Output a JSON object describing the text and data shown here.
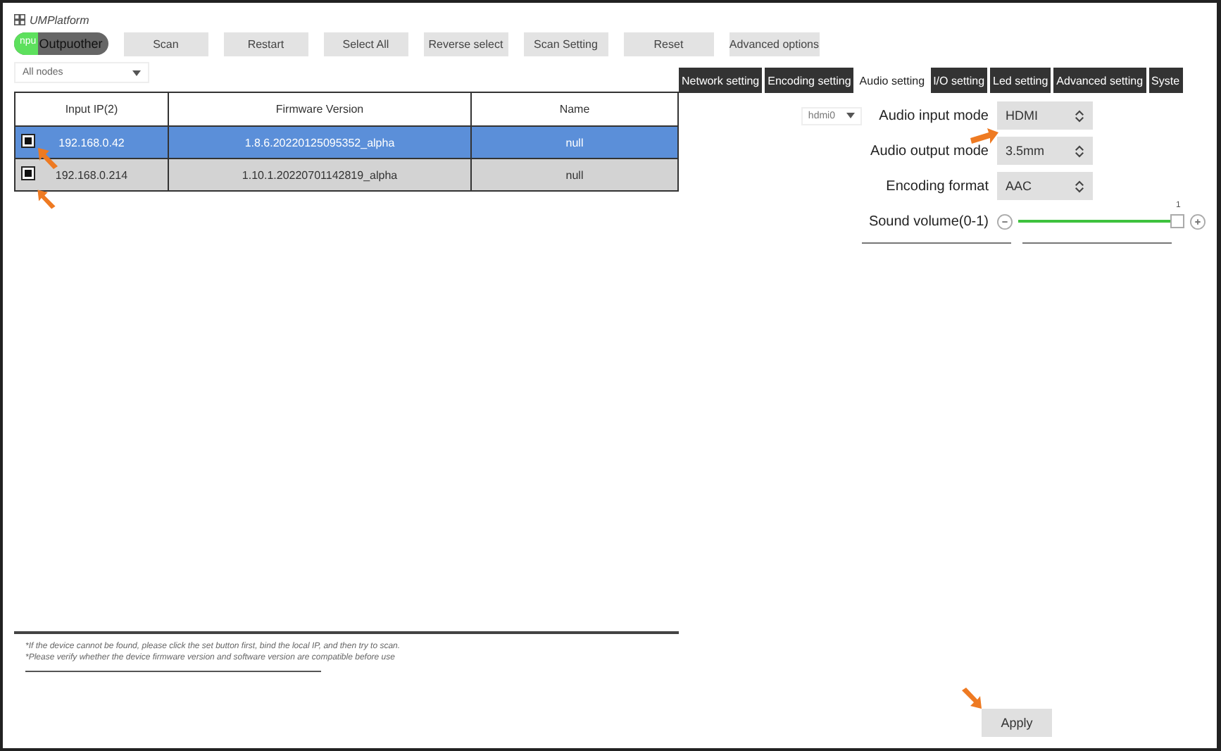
{
  "window": {
    "title": "UMPlatform"
  },
  "toolbar": {
    "toggle": {
      "off_label": "npu",
      "on_label": "Outpuother",
      "on": true
    },
    "buttons": [
      "Scan",
      "Restart",
      "Select All",
      "Reverse select",
      "Scan Setting",
      "Reset",
      "Advanced options"
    ]
  },
  "node_filter": {
    "value": "All nodes"
  },
  "table": {
    "columns": [
      "Input IP(2)",
      "Firmware Version",
      "Name"
    ],
    "rows": [
      {
        "checked": true,
        "selected": true,
        "cells": [
          "192.168.0.42",
          "1.8.6.20220125095352_alpha",
          "null"
        ]
      },
      {
        "checked": true,
        "selected": false,
        "cells": [
          "192.168.0.214",
          "1.10.1.20220701142819_alpha",
          "null"
        ]
      }
    ]
  },
  "notes": [
    "*If the device cannot be found, please click the set button first, bind the local IP, and then try to scan.",
    "*Please verify whether the device firmware version and software version are compatible before use"
  ],
  "tabs": [
    {
      "label": "Network setting",
      "selected": false
    },
    {
      "label": "Encoding setting",
      "selected": false
    },
    {
      "label": "Audio setting",
      "selected": true
    },
    {
      "label": "I/O setting",
      "selected": false
    },
    {
      "label": "Led setting",
      "selected": false
    },
    {
      "label": "Advanced setting",
      "selected": false
    },
    {
      "label": "Syste",
      "selected": false
    }
  ],
  "settings": [
    {
      "kind": "select",
      "source": "hdmi0",
      "label": "Audio input mode",
      "value": "HDMI"
    },
    {
      "kind": "select",
      "label": "Audio output mode",
      "value": "3.5mm"
    },
    {
      "kind": "select",
      "label": "Encoding format",
      "value": "AAC"
    },
    {
      "kind": "slider",
      "label": "Sound volume(0-1)",
      "reading": "1",
      "level": 1
    }
  ],
  "apply_button": "Apply"
}
